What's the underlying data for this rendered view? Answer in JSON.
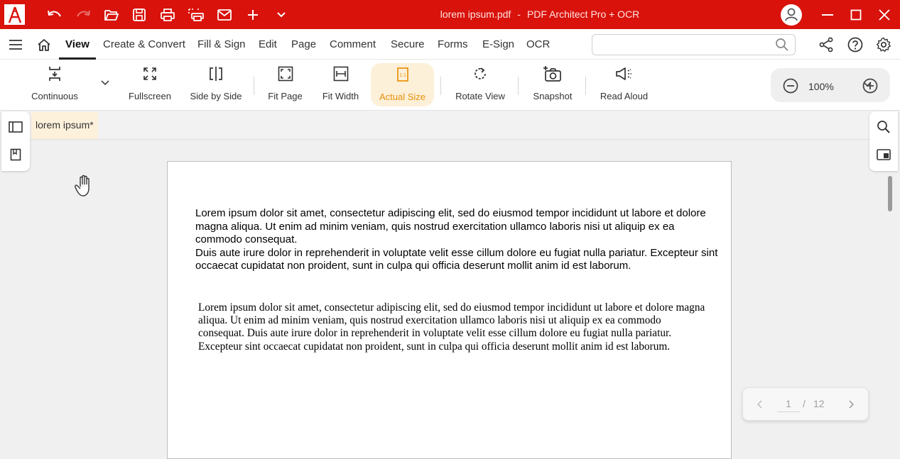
{
  "app": {
    "file_name": "lorem ipsum.pdf",
    "title_separator": "-",
    "product_name": "PDF Architect Pro + OCR",
    "colors": {
      "brand_red": "#d9120c",
      "accent_orange": "#e8900a"
    }
  },
  "quick_access": [
    "undo-icon",
    "redo-icon",
    "open-folder-icon",
    "save-icon",
    "print-icon",
    "scan-print-icon",
    "email-icon",
    "new-icon",
    "more-chevron-icon"
  ],
  "menu": {
    "items": [
      {
        "label": "View",
        "active": true
      },
      {
        "label": "Create & Convert"
      },
      {
        "label": "Fill & Sign"
      },
      {
        "label": "Edit"
      },
      {
        "label": "Page"
      },
      {
        "label": "Comment"
      },
      {
        "label": "Secure"
      },
      {
        "label": "Forms"
      },
      {
        "label": "E-Sign"
      },
      {
        "label": "OCR"
      }
    ],
    "search_placeholder": ""
  },
  "ribbon": {
    "continuous": "Continuous",
    "fullscreen": "Fullscreen",
    "side_by_side": "Side by Side",
    "fit_page": "Fit Page",
    "fit_width": "Fit Width",
    "actual_size": "Actual Size",
    "rotate_view": "Rotate View",
    "snapshot": "Snapshot",
    "read_aloud": "Read Aloud",
    "zoom": "100%"
  },
  "document": {
    "tab_label": "lorem ipsum*",
    "paragraph_sans_1": "Lorem ipsum dolor sit amet, consectetur adipiscing elit, sed do eiusmod tempor incididunt ut labore et dolore magna aliqua. Ut enim ad minim veniam, quis nostrud exercitation ullamco laboris nisi ut aliquip ex ea commodo consequat.",
    "paragraph_sans_2": "Duis aute irure dolor in reprehenderit in voluptate velit esse cillum dolore eu fugiat nulla pariatur. Excepteur sint occaecat cupidatat non proident, sunt in culpa qui officia deserunt mollit anim id est laborum.",
    "paragraph_serif": "Lorem ipsum dolor sit amet, consectetur adipiscing elit, sed do eiusmod tempor incididunt ut labore et dolore magna aliqua. Ut enim ad minim veniam, quis nostrud exercitation ullamco laboris nisi ut aliquip ex ea commodo consequat. Duis aute irure dolor in reprehenderit in voluptate velit esse cillum dolore eu fugiat nulla pariatur. Excepteur sint occaecat cupidatat non proident, sunt in culpa qui officia deserunt mollit anim id est laborum."
  },
  "pager": {
    "current": "1",
    "separator": "/",
    "total": "12"
  }
}
